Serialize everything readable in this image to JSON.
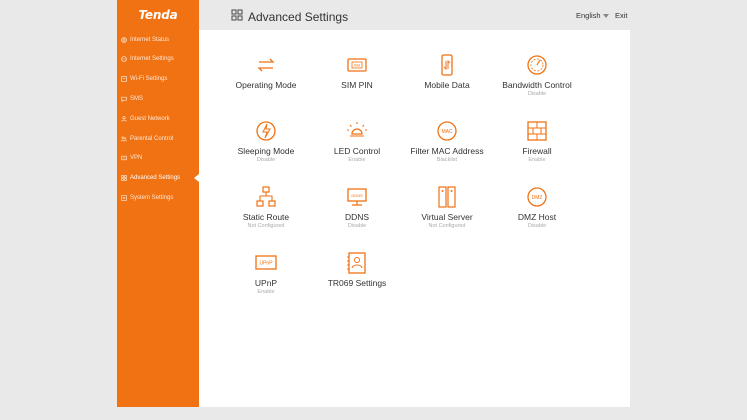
{
  "brand": {
    "logo_text": "Tenda",
    "accent": "#f07213"
  },
  "sidebar": {
    "items": [
      {
        "label": "Internet Status",
        "icon": "globe-icon"
      },
      {
        "label": "Internet Settings",
        "icon": "globe-icon"
      },
      {
        "label": "Wi-Fi Settings",
        "icon": "wifi-icon"
      },
      {
        "label": "SMS",
        "icon": "message-icon"
      },
      {
        "label": "Guest Network",
        "icon": "guest-icon"
      },
      {
        "label": "Parental Control",
        "icon": "family-icon"
      },
      {
        "label": "VPN",
        "icon": "vpn-icon"
      },
      {
        "label": "Advanced Settings",
        "icon": "grid-icon",
        "active": true
      },
      {
        "label": "System Settings",
        "icon": "system-icon"
      }
    ]
  },
  "header": {
    "title": "Advanced Settings",
    "language": "English",
    "exit": "Exit"
  },
  "tiles": [
    {
      "label": "Operating Mode",
      "status": "",
      "icon": "operating-mode-icon"
    },
    {
      "label": "SIM PIN",
      "status": "",
      "icon": "sim-card-icon",
      "icon_text": "SIM"
    },
    {
      "label": "Mobile Data",
      "status": "",
      "icon": "mobile-data-icon"
    },
    {
      "label": "Bandwidth Control",
      "status": "Disable",
      "icon": "bandwidth-icon"
    },
    {
      "label": "Sleeping Mode",
      "status": "Disable",
      "icon": "sleep-icon"
    },
    {
      "label": "LED Control",
      "status": "Enable",
      "icon": "led-icon"
    },
    {
      "label": "Filter MAC Address",
      "status": "Blacklist",
      "icon": "mac-filter-icon",
      "icon_text": "MAC"
    },
    {
      "label": "Firewall",
      "status": "Enable",
      "icon": "firewall-icon"
    },
    {
      "label": "Static Route",
      "status": "Not Configured",
      "icon": "static-route-icon"
    },
    {
      "label": "DDNS",
      "status": "Disable",
      "icon": "ddns-icon",
      "icon_text": "DDNS"
    },
    {
      "label": "Virtual Server",
      "status": "Not Configured",
      "icon": "virtual-server-icon"
    },
    {
      "label": "DMZ Host",
      "status": "Disable",
      "icon": "dmz-icon",
      "icon_text": "DMZ"
    },
    {
      "label": "UPnP",
      "status": "Enable",
      "icon": "upnp-icon",
      "icon_text": "UPnP"
    },
    {
      "label": "TR069 Settings",
      "status": "",
      "icon": "tr069-icon"
    }
  ]
}
